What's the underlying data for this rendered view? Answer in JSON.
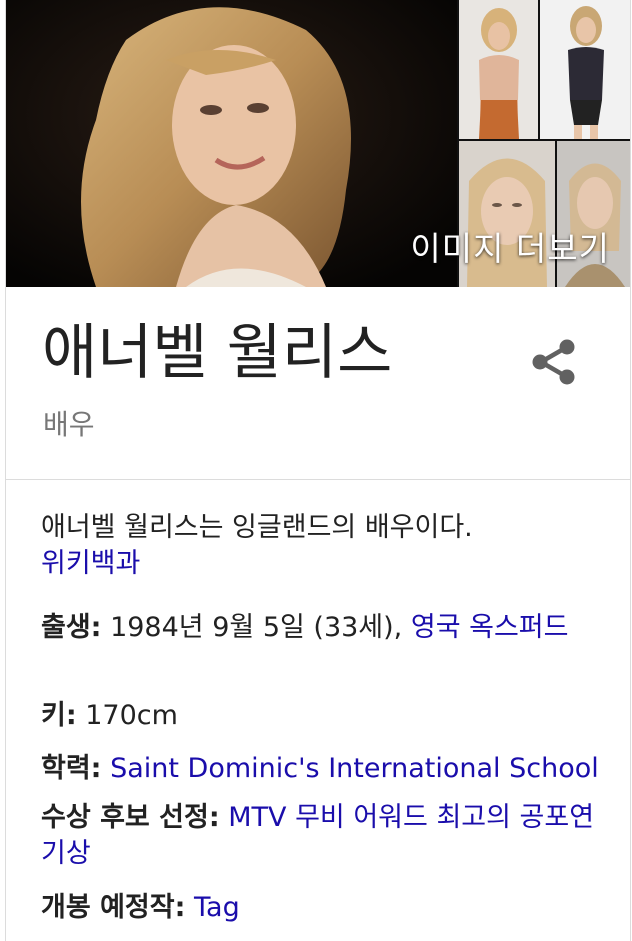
{
  "images": {
    "more_label": "이미지 더보기"
  },
  "entity": {
    "title": "애너벨 월리스",
    "subtitle": "배우"
  },
  "description": {
    "text": "애너벨 월리스는 잉글랜드의 배우이다.",
    "source": "위키백과"
  },
  "facts": [
    {
      "label": "출생:",
      "plain": "1984년 9월 5일 (33세),",
      "link": "영국 옥스퍼드"
    },
    {
      "label": "키:",
      "plain": "170cm",
      "link": ""
    },
    {
      "label": "학력:",
      "plain": "",
      "link": "Saint Dominic's International School"
    },
    {
      "label": "수상 후보 선정:",
      "plain": "",
      "link": "MTV 무비 어워드 최고의 공포연기상"
    },
    {
      "label": "개봉 예정작:",
      "plain": "",
      "link": "Tag"
    }
  ],
  "colors": {
    "link": "#1a0dab",
    "subtitle": "#777777",
    "share_icon": "#616161"
  }
}
